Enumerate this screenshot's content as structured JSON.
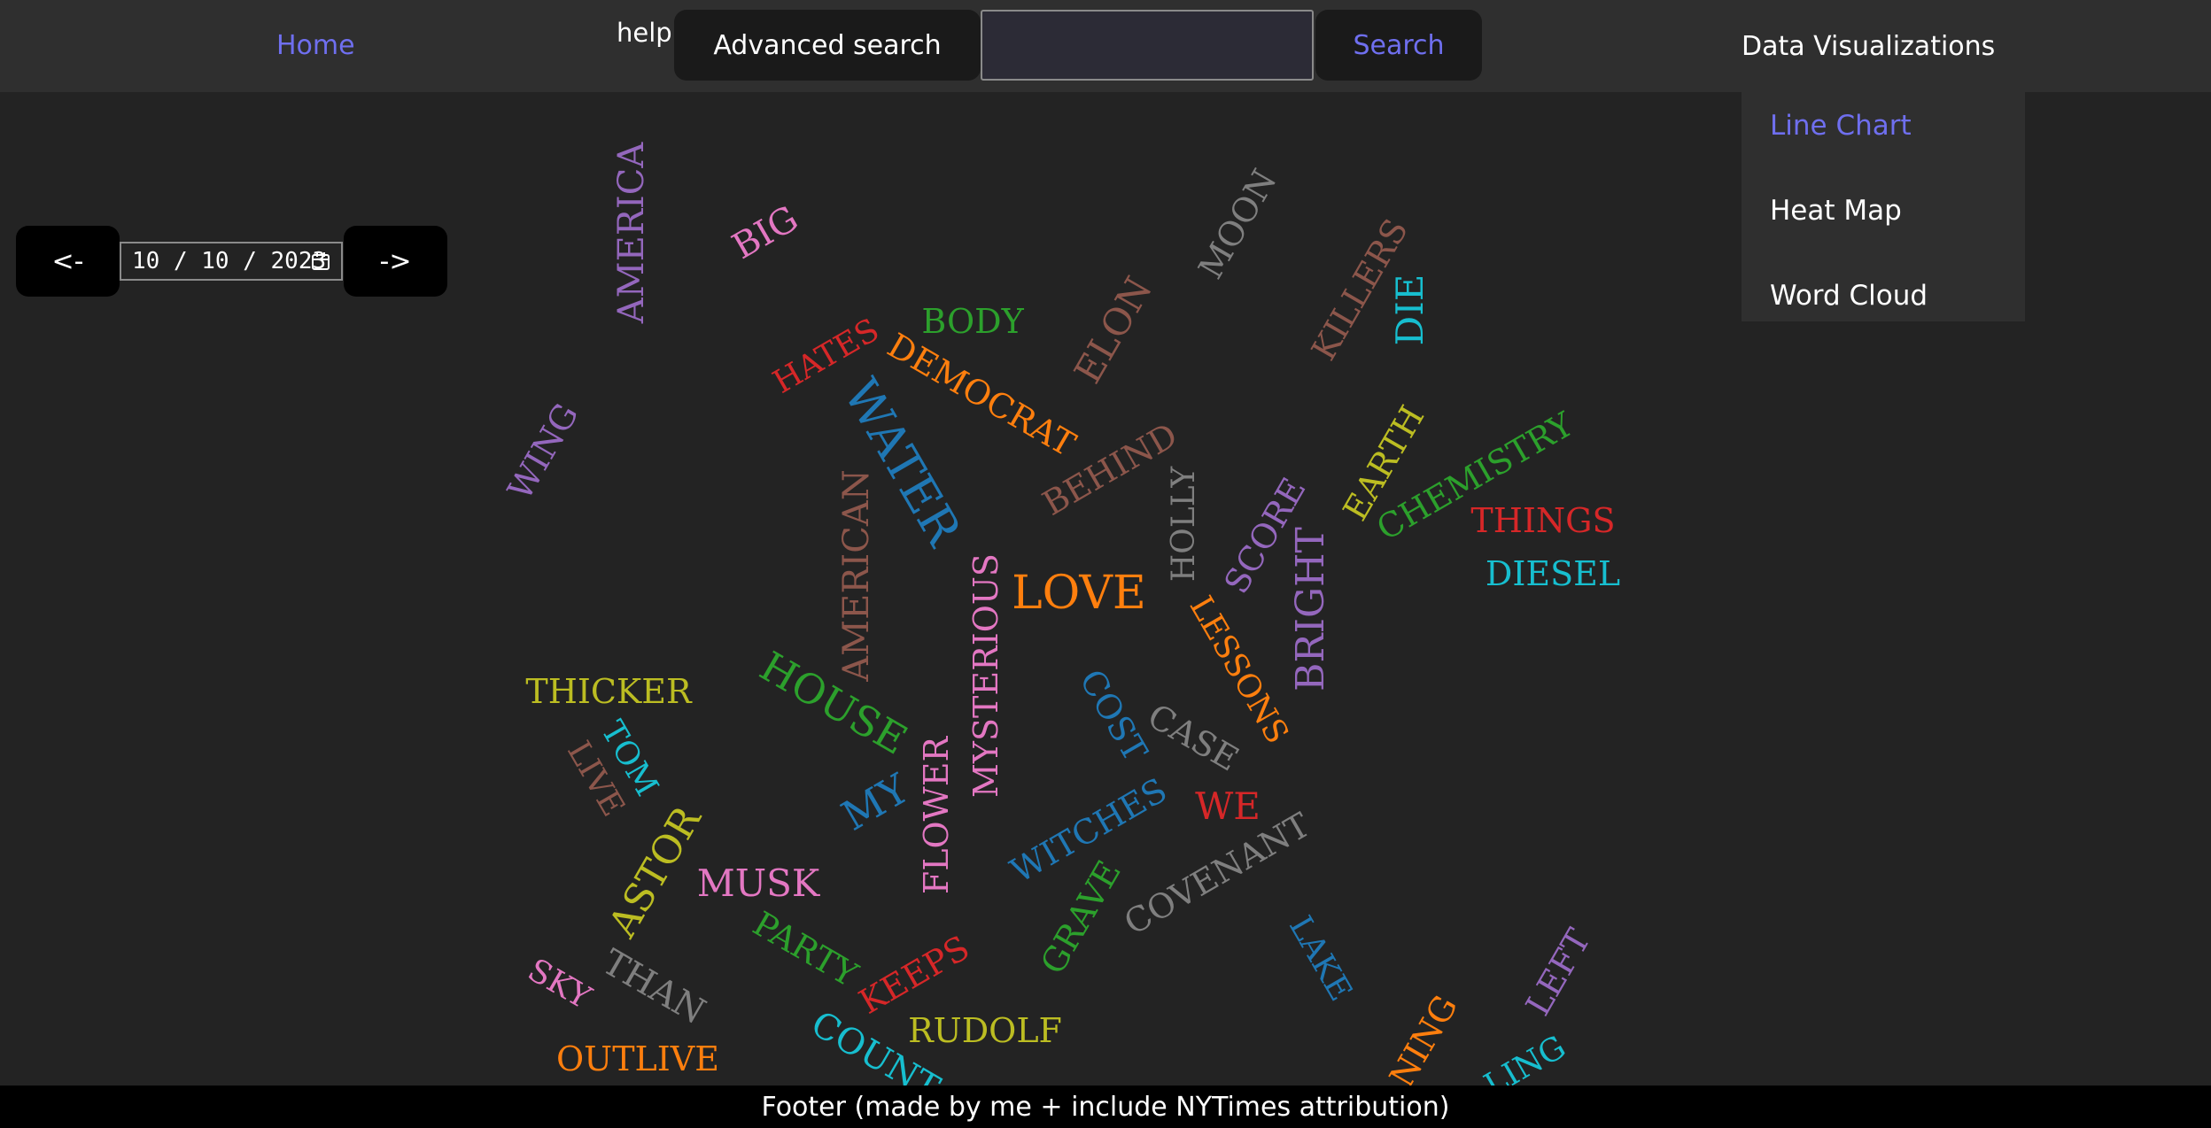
{
  "nav": {
    "home": "Home",
    "help": "help",
    "advanced_search": "Advanced search",
    "search_value": "",
    "search_placeholder": "",
    "search_button": "Search",
    "data_viz": "Data Visualizations"
  },
  "dropdown": {
    "items": [
      "Line Chart",
      "Heat Map",
      "Word Cloud"
    ],
    "active": "Line Chart"
  },
  "date_nav": {
    "prev": "<-",
    "next": "->",
    "date": "10 / 10 / 2023"
  },
  "wordcloud": {
    "words": [
      {
        "text": "AMERICA",
        "color": "#9467bd"
      },
      {
        "text": "BIG",
        "color": "#e377c2"
      },
      {
        "text": "MOON",
        "color": "#7f7f7f"
      },
      {
        "text": "KILLERS",
        "color": "#8c564b"
      },
      {
        "text": "DIE",
        "color": "#17becf"
      },
      {
        "text": "BODY",
        "color": "#2ca02c"
      },
      {
        "text": "ELON",
        "color": "#8c564b"
      },
      {
        "text": "HATES",
        "color": "#d62728"
      },
      {
        "text": "DEMOCRAT",
        "color": "#ff7f0e"
      },
      {
        "text": "WATER",
        "color": "#1f77b4"
      },
      {
        "text": "WING",
        "color": "#9467bd"
      },
      {
        "text": "BEHIND",
        "color": "#8c564b"
      },
      {
        "text": "HOLLY",
        "color": "#7f7f7f"
      },
      {
        "text": "EARTH",
        "color": "#bcbd22"
      },
      {
        "text": "CHEMISTRY",
        "color": "#2ca02c"
      },
      {
        "text": "THINGS",
        "color": "#d62728"
      },
      {
        "text": "DIESEL",
        "color": "#17becf"
      },
      {
        "text": "SCORE",
        "color": "#9467bd"
      },
      {
        "text": "AMERICAN",
        "color": "#8c564b"
      },
      {
        "text": "MYSTERIOUS",
        "color": "#e377c2"
      },
      {
        "text": "LOVE",
        "color": "#ff7f0e"
      },
      {
        "text": "BRIGHT",
        "color": "#9467bd"
      },
      {
        "text": "LESSONS",
        "color": "#ff7f0e"
      },
      {
        "text": "THICKER",
        "color": "#bcbd22"
      },
      {
        "text": "HOUSE",
        "color": "#2ca02c"
      },
      {
        "text": "COST",
        "color": "#1f77b4"
      },
      {
        "text": "CASE",
        "color": "#7f7f7f"
      },
      {
        "text": "TOM",
        "color": "#17becf"
      },
      {
        "text": "LIVE",
        "color": "#8c564b"
      },
      {
        "text": "MY",
        "color": "#1f77b4"
      },
      {
        "text": "FLOWER",
        "color": "#e377c2"
      },
      {
        "text": "WE",
        "color": "#d62728"
      },
      {
        "text": "WITCHES",
        "color": "#1f77b4"
      },
      {
        "text": "ASTOR",
        "color": "#bcbd22"
      },
      {
        "text": "COVENANT",
        "color": "#7f7f7f"
      },
      {
        "text": "MUSK",
        "color": "#e377c2"
      },
      {
        "text": "GRAVE",
        "color": "#2ca02c"
      },
      {
        "text": "LAKE",
        "color": "#1f77b4"
      },
      {
        "text": "PARTY",
        "color": "#2ca02c"
      },
      {
        "text": "LEFT",
        "color": "#9467bd"
      },
      {
        "text": "SKY",
        "color": "#e377c2"
      },
      {
        "text": "THAN",
        "color": "#7f7f7f"
      },
      {
        "text": "KEEPS",
        "color": "#d62728"
      },
      {
        "text": "RUDOLF",
        "color": "#bcbd22"
      },
      {
        "text": "COUNT",
        "color": "#17becf"
      },
      {
        "text": "OUTLIVE",
        "color": "#ff7f0e"
      },
      {
        "text": "NING",
        "color": "#ff7f0e"
      },
      {
        "text": "LING",
        "color": "#17becf"
      }
    ]
  },
  "footer": {
    "text": "Footer (made by me + include NYTimes attribution)"
  }
}
